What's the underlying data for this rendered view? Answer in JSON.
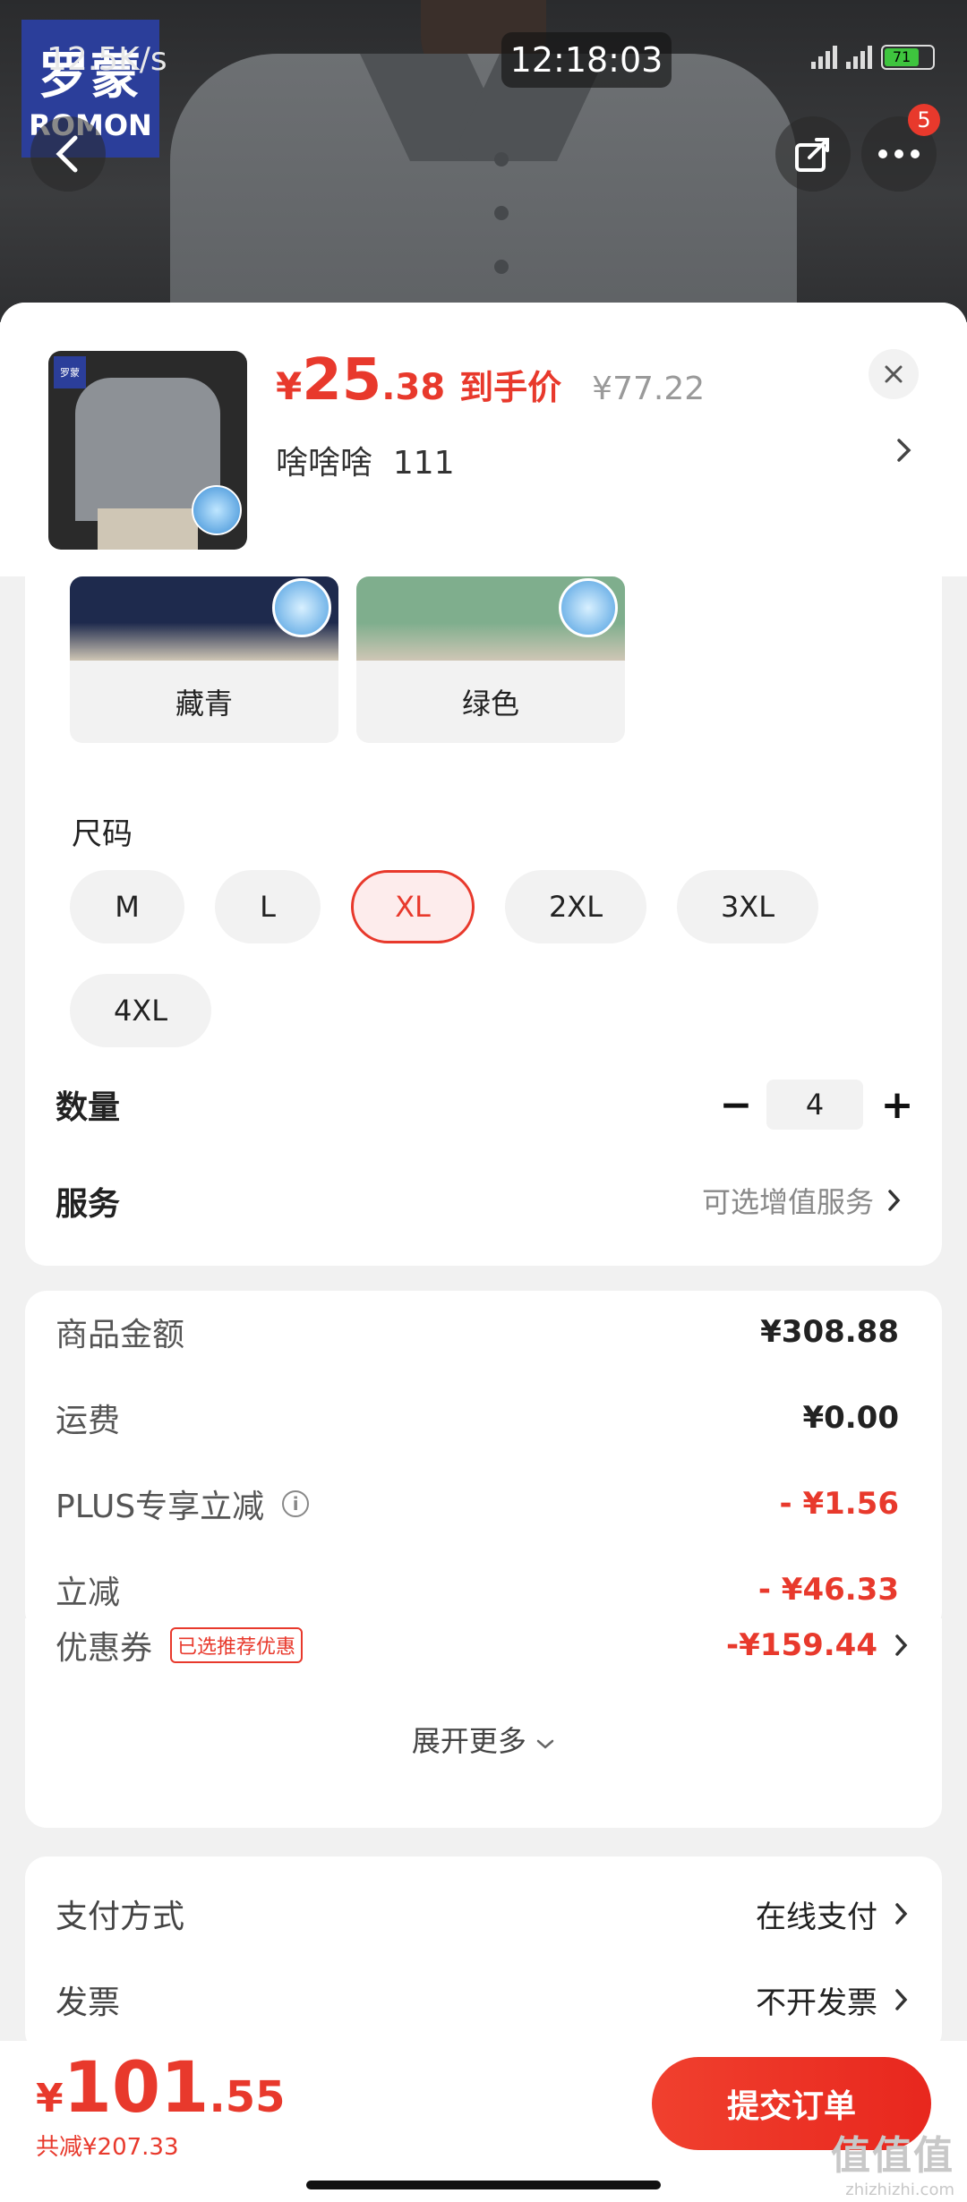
{
  "status_bar": {
    "network_speed": "12.5K/s",
    "time": "12:18:03",
    "battery": "71"
  },
  "brand": {
    "name_cn": "罗蒙",
    "name_en": "ROMON"
  },
  "header": {
    "more_badge": "5"
  },
  "product": {
    "price_symbol": "¥",
    "price_int": "25",
    "price_dec": ".38",
    "price_tag": "到手价",
    "original_price": "¥77.22",
    "variant_name": "啥啥啥",
    "variant_code": "111"
  },
  "colors": [
    {
      "label": "藏青",
      "swatch": "#1e2a4d"
    },
    {
      "label": "绿色",
      "swatch": "#7fae8d"
    }
  ],
  "sizes": {
    "title": "尺码",
    "options": [
      "M",
      "L",
      "XL",
      "2XL",
      "3XL",
      "4XL"
    ],
    "selected": "XL"
  },
  "quantity": {
    "label": "数量",
    "value": "4",
    "minus": "−",
    "plus": "+"
  },
  "service": {
    "label": "服务",
    "hint": "可选增值服务"
  },
  "summary": {
    "goods_label": "商品金额",
    "goods_value": "¥308.88",
    "shipping_label": "运费",
    "shipping_value": "¥0.00",
    "plus_label": "PLUS专享立减",
    "plus_value": "- ¥1.56",
    "discount_label": "立减",
    "discount_value": "- ¥46.33",
    "coupon_label": "优惠券",
    "coupon_tag": "已选推荐优惠",
    "coupon_value": "-¥159.44",
    "expand_label": "展开更多"
  },
  "payment": {
    "method_label": "支付方式",
    "method_value": "在线支付",
    "invoice_label": "发票",
    "invoice_value": "不开发票"
  },
  "footer": {
    "total_symbol": "¥",
    "total_int": "101",
    "total_dec": ".55",
    "saved": "共减¥207.33",
    "submit_label": "提交订单",
    "watermark": "值值值",
    "watermark_url": "zhizhizhi.com"
  },
  "colors_theme": {
    "accent": "#e8392c",
    "background": "#f1f1f1"
  }
}
